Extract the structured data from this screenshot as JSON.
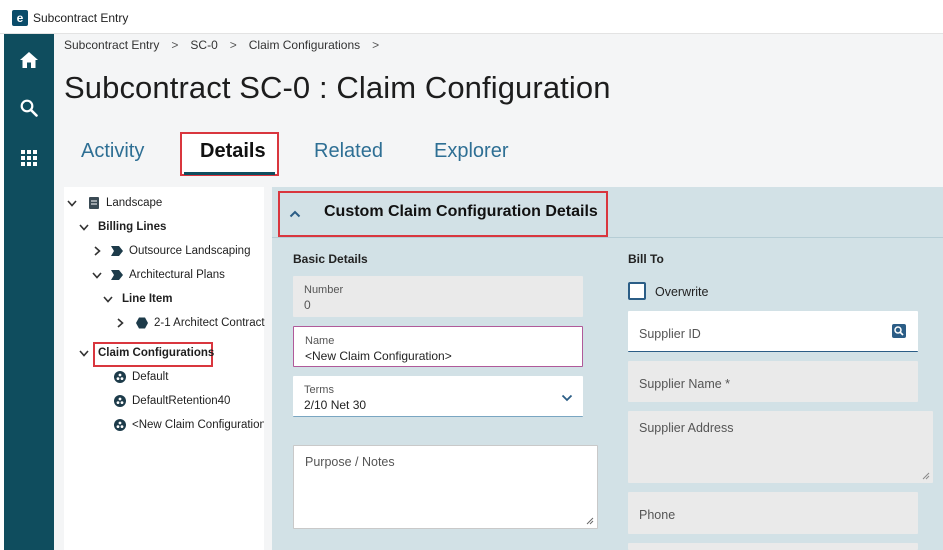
{
  "window": {
    "title": "Subcontract Entry",
    "logo_letter": "e"
  },
  "breadcrumb": [
    "Subcontract Entry",
    "SC-0",
    "Claim Configurations"
  ],
  "breadcrumb_sep": ">",
  "page_title": "Subcontract SC-0 : Claim Configuration",
  "tabs": [
    {
      "label": "Activity",
      "active": false
    },
    {
      "label": "Details",
      "active": true
    },
    {
      "label": "Related",
      "active": false
    },
    {
      "label": "Explorer",
      "active": false
    }
  ],
  "tree": {
    "root": "Landscape",
    "billing_lines": "Billing Lines",
    "outsource": "Outsource Landscaping",
    "architectural": "Architectural Plans",
    "line_item": "Line Item",
    "architect_contract": "2-1 Architect Contract",
    "claim_configurations": "Claim Configurations",
    "claims": [
      "Default",
      "DefaultRetention40",
      "<New Claim Configuration>"
    ]
  },
  "section": {
    "title": "Custom Claim Configuration Details"
  },
  "basic_details": {
    "heading": "Basic Details",
    "number_label": "Number",
    "number_value": "0",
    "name_label": "Name",
    "name_value": "<New Claim Configuration>",
    "terms_label": "Terms",
    "terms_value": "2/10 Net 30",
    "notes_placeholder": "Purpose / Notes"
  },
  "bill_to": {
    "heading": "Bill To",
    "overwrite_label": "Overwrite",
    "overwrite_checked": false,
    "supplier_id": "Supplier ID",
    "supplier_name": "Supplier Name *",
    "supplier_address": "Supplier Address",
    "phone": "Phone"
  },
  "colors": {
    "nav": "#0f4d5e",
    "accent": "#2e6f94",
    "highlight": "#d9363e",
    "panel": "#d2e1e6"
  }
}
